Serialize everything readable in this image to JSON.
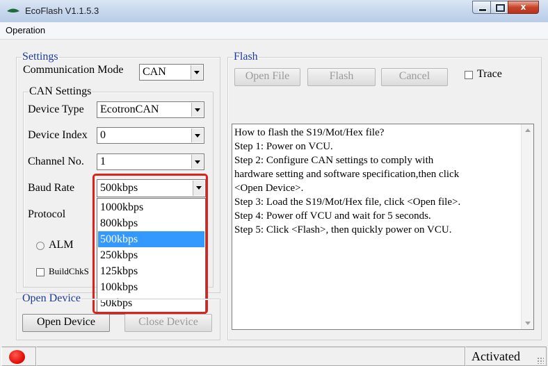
{
  "window": {
    "title": "EcoFlash V1.1.5.3",
    "app_icon": "ecoflash-logo-icon",
    "controls": {
      "minimize": "minimize-icon",
      "maximize": "maximize-icon",
      "close_glyph": "x"
    }
  },
  "menu": {
    "items": [
      "Operation"
    ]
  },
  "settings": {
    "legend": "Settings",
    "comm_mode_label": "Communication Mode",
    "comm_mode_value": "CAN",
    "can_settings": {
      "legend": "CAN Settings",
      "device_type_label": "Device Type",
      "device_type_value": "EcotronCAN",
      "device_index_label": "Device Index",
      "device_index_value": "0",
      "channel_label": "Channel No.",
      "channel_value": "1",
      "baud_label": "Baud Rate",
      "baud_value": "500kbps",
      "protocol_label": "Protocol",
      "alm_label": "ALM",
      "buildchk_label": "BuildChkS"
    }
  },
  "baud_dropdown": {
    "options": [
      "1000kbps",
      "800kbps",
      "500kbps",
      "250kbps",
      "125kbps",
      "100kbps",
      "50kbps"
    ],
    "selected_index": 2,
    "highlight_color": "#e0201b"
  },
  "open_device": {
    "legend": "Open Device",
    "open_button": "Open Device",
    "close_button": "Close Device"
  },
  "flash": {
    "legend": "Flash",
    "open_file_button": "Open File",
    "flash_button": "Flash",
    "cancel_button": "Cancel",
    "trace_label": "Trace",
    "instructions": [
      "How to flash the S19/Mot/Hex file?",
      "Step 1: Power on VCU.",
      "Step 2: Configure CAN settings to comply with",
      "hardware setting and software specification,then click",
      "<Open Device>.",
      "Step 3: Load the S19/Mot/Hex file, click <Open file>.",
      "Step 4: Power off VCU and wait for 5 seconds.",
      "Step 5: Click <Flash>, then quickly power on VCU."
    ]
  },
  "statusbar": {
    "indicator_color": "#e3120b",
    "status": "Activated"
  },
  "colors": {
    "legend_blue": "#1a3a9a",
    "selection": "#3399ff"
  }
}
